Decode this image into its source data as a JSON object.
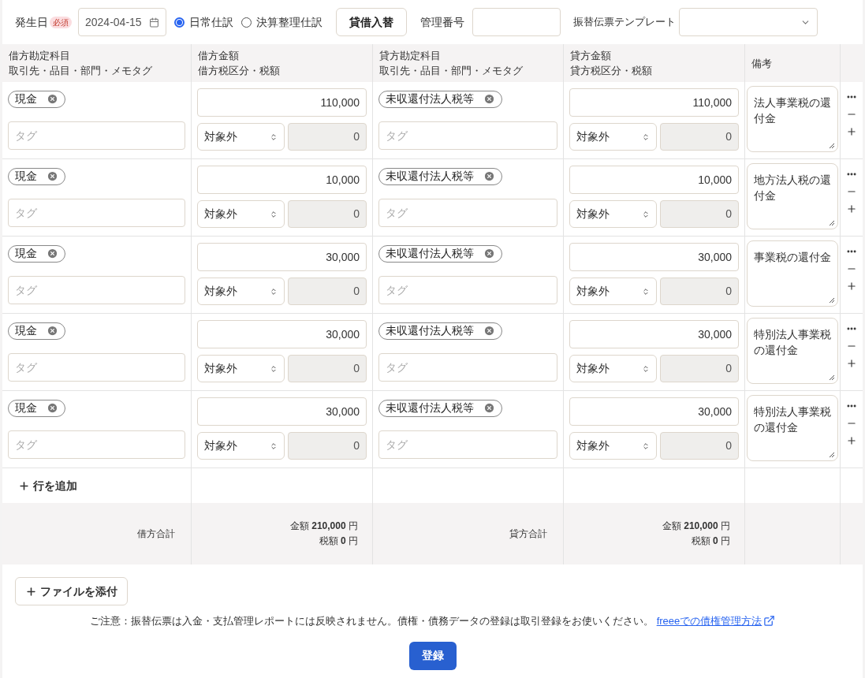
{
  "header": {
    "date_label": "発生日",
    "required_badge": "必須",
    "date": "2024-04-15",
    "journal_types": [
      {
        "label": "日常仕訳",
        "selected": true
      },
      {
        "label": "決算整理仕訳",
        "selected": false
      }
    ],
    "swap_button": "貸借入替",
    "number_label": "管理番号",
    "template_label": "振替伝票テンプレート"
  },
  "table": {
    "columns": [
      {
        "line1": "借方勘定科目",
        "line2": "取引先・品目・部門・メモタグ"
      },
      {
        "line1": "借方金額",
        "line2": "借方税区分・税額"
      },
      {
        "line1": "貸方勘定科目",
        "line2": "取引先・品目・部門・メモタグ"
      },
      {
        "line1": "貸方金額",
        "line2": "貸方税区分・税額"
      },
      {
        "line1": "備考"
      }
    ],
    "rows": [
      {
        "debit_account": "現金",
        "debit_tag_placeholder": "タグ",
        "debit_amount": "110,000",
        "debit_tax": "対象外",
        "debit_tax_amount": "0",
        "credit_account": "未収還付法人税等",
        "credit_tag_placeholder": "タグ",
        "credit_amount": "110,000",
        "credit_tax": "対象外",
        "credit_tax_amount": "0",
        "memo": "法人事業税の還付金"
      },
      {
        "debit_account": "現金",
        "debit_tag_placeholder": "タグ",
        "debit_amount": "10,000",
        "debit_tax": "対象外",
        "debit_tax_amount": "0",
        "credit_account": "未収還付法人税等",
        "credit_tag_placeholder": "タグ",
        "credit_amount": "10,000",
        "credit_tax": "対象外",
        "credit_tax_amount": "0",
        "memo": "地方法人税の還付金"
      },
      {
        "debit_account": "現金",
        "debit_tag_placeholder": "タグ",
        "debit_amount": "30,000",
        "debit_tax": "対象外",
        "debit_tax_amount": "0",
        "credit_account": "未収還付法人税等",
        "credit_tag_placeholder": "タグ",
        "credit_amount": "30,000",
        "credit_tax": "対象外",
        "credit_tax_amount": "0",
        "memo": "事業税の還付金"
      },
      {
        "debit_account": "現金",
        "debit_tag_placeholder": "タグ",
        "debit_amount": "30,000",
        "debit_tax": "対象外",
        "debit_tax_amount": "0",
        "credit_account": "未収還付法人税等",
        "credit_tag_placeholder": "タグ",
        "credit_amount": "30,000",
        "credit_tax": "対象外",
        "credit_tax_amount": "0",
        "memo": "特別法人事業税の還付金"
      },
      {
        "debit_account": "現金",
        "debit_tag_placeholder": "タグ",
        "debit_amount": "30,000",
        "debit_tax": "対象外",
        "debit_tax_amount": "0",
        "credit_account": "未収還付法人税等",
        "credit_tag_placeholder": "タグ",
        "credit_amount": "30,000",
        "credit_tax": "対象外",
        "credit_tax_amount": "0",
        "memo": "特別法人事業税の還付金"
      }
    ],
    "add_row": "行を追加",
    "totals": {
      "debit_label": "借方合計",
      "debit_amount": "金額 **210,000** 円",
      "debit_tax": "税額 **0** 円",
      "credit_label": "貸方合計",
      "credit_amount": "金額 **210,000** 円",
      "credit_tax": "税額 **0** 円"
    }
  },
  "attach_button": "ファイルを添付",
  "notice": "ご注意：振替伝票は入金・支払管理レポートには反映されません。債権・債務データの登録は取引登録をお使いください。",
  "notice_link": "freeeでの債権管理方法",
  "submit_button": "登録"
}
